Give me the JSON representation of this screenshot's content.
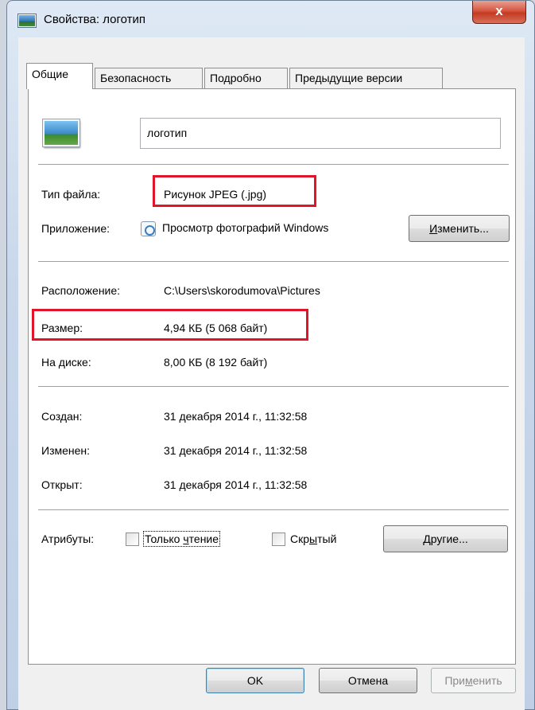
{
  "window": {
    "title": "Свойства: логотип",
    "close_glyph": "x"
  },
  "tabs": [
    "Общие",
    "Безопасность",
    "Подробно",
    "Предыдущие версии"
  ],
  "file": {
    "name": "логотип"
  },
  "type_row": {
    "label": "Тип файла:",
    "value": "Рисунок JPEG (.jpg)"
  },
  "app_row": {
    "label": "Приложение:",
    "value": "Просмотр фотографий Windows",
    "change_button_pre": "",
    "change_button_key": "И",
    "change_button_post": "зменить..."
  },
  "location_row": {
    "label": "Расположение:",
    "value": "C:\\Users\\skorodumova\\Pictures"
  },
  "size_row": {
    "label": "Размер:",
    "value": "4,94 КБ (5 068 байт)"
  },
  "disk_row": {
    "label": "На диске:",
    "value": "8,00 КБ (8 192 байт)"
  },
  "created_row": {
    "label": "Создан:",
    "value": "31 декабря 2014 г., 11:32:58"
  },
  "modified_row": {
    "label": "Изменен:",
    "value": "31 декабря 2014 г., 11:32:58"
  },
  "opened_row": {
    "label": "Открыт:",
    "value": "31 декабря 2014 г., 11:32:58"
  },
  "attributes": {
    "label": "Атрибуты:",
    "readonly_pre": "Только ",
    "readonly_key": "ч",
    "readonly_post": "тение",
    "hidden_pre": "Скр",
    "hidden_key": "ы",
    "hidden_post": "тый",
    "other_pre": "",
    "other_key": "Д",
    "other_post": "ругие..."
  },
  "footer": {
    "ok": "OK",
    "cancel": "Отмена",
    "apply_pre": "При",
    "apply_key": "м",
    "apply_post": "енить"
  },
  "colors": {
    "highlight": "#e0142b",
    "close_button": "#c33a22",
    "window_frame": "#bfd0e6"
  },
  "icons": {
    "title": "image-file-icon",
    "thumbnail": "jpeg-thumbnail-icon",
    "app": "photo-viewer-icon"
  }
}
